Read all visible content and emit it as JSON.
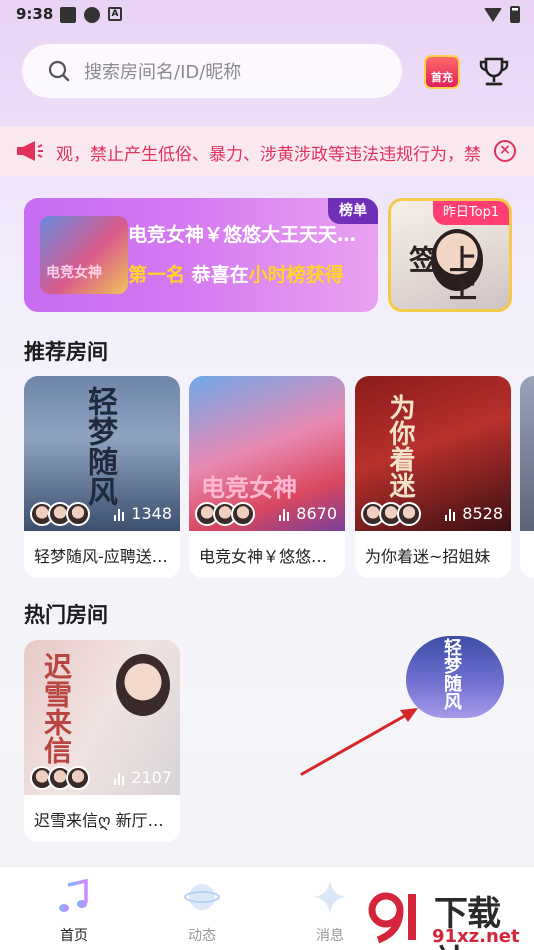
{
  "status": {
    "time": "9:38"
  },
  "search": {
    "placeholder": "搜索房间名/ID/昵称"
  },
  "header": {
    "recharge_label": "首充"
  },
  "notice": {
    "text": "观，禁止产生低俗、暴力、涉黄涉政等违法违规行为，禁"
  },
  "banner": {
    "thumb_text": "电竞女神",
    "title": "电竞女神￥悠悠大王天天…",
    "sub_gold_1": "第一名",
    "sub_white": "恭喜在",
    "sub_gold_2": "小时榜获得",
    "tag": "榜单"
  },
  "banner_side": {
    "tag": "昨日Top1",
    "art_text": "上上签"
  },
  "sections": {
    "recommended": "推荐房间",
    "hot": "热门房间"
  },
  "recommended_rooms": [
    {
      "name": "轻梦随风-应聘送…",
      "count": "1348",
      "art_text": "轻梦随风"
    },
    {
      "name": "电竞女神￥悠悠…",
      "count": "8670",
      "art_text": "电竞女神"
    },
    {
      "name": "为你着迷~招姐妹",
      "count": "8528",
      "art_text": "为你着迷"
    }
  ],
  "hot_rooms": [
    {
      "name": "迟雪来信ღ 新厅…",
      "count": "2107",
      "art_text": "迟雪来信"
    }
  ],
  "floating_room": {
    "art_text": "轻梦随风"
  },
  "nav": [
    {
      "label": "首页",
      "active": true
    },
    {
      "label": "动态",
      "active": false
    },
    {
      "label": "消息",
      "active": false
    }
  ],
  "watermark": {
    "name": "下载站",
    "url": "91xz.net"
  },
  "colors": {
    "accent": "#e0325d",
    "gold": "#ffd42a",
    "banner_purple": "#c66cf0"
  }
}
